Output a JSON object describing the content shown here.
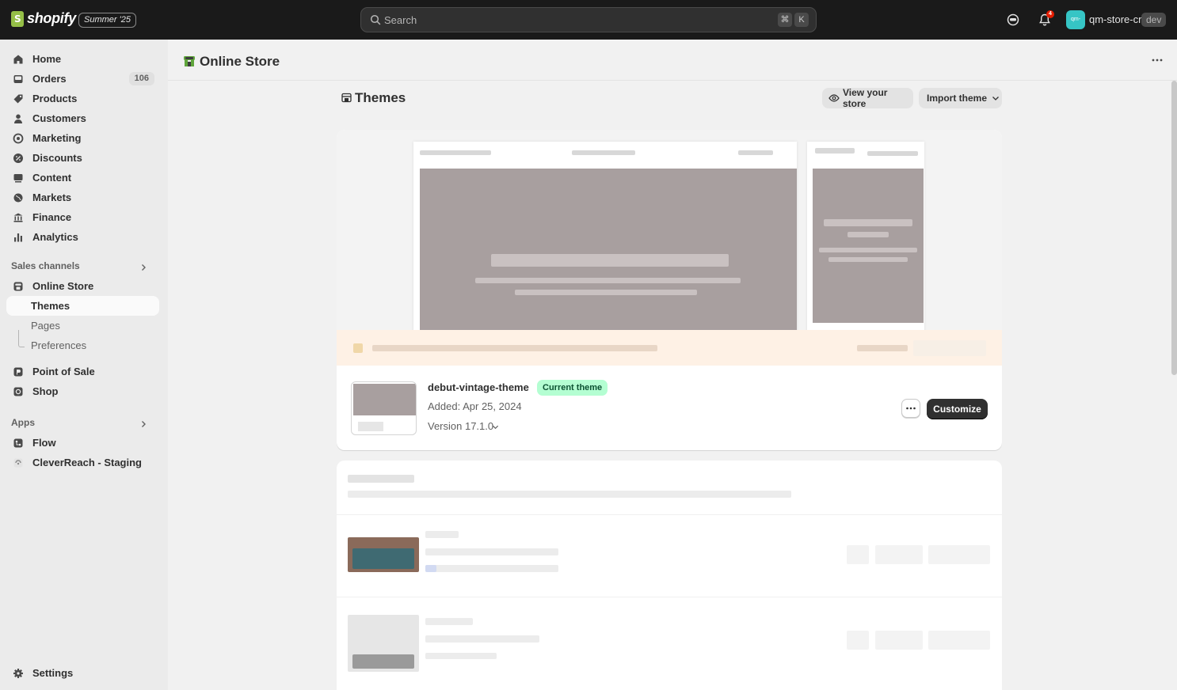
{
  "topbar": {
    "brand": "shopify",
    "edition_badge": "Summer '25",
    "search_placeholder": "Search",
    "shortcut_keys": [
      "⌘",
      "K"
    ],
    "notification_count": "4",
    "avatar_initials": "qm-",
    "store_name": "qm-store-cr",
    "env_badge": "dev"
  },
  "sidebar": {
    "items": [
      {
        "label": "Home",
        "icon": "home-icon"
      },
      {
        "label": "Orders",
        "icon": "inbox-icon",
        "count": "106"
      },
      {
        "label": "Products",
        "icon": "tag-icon"
      },
      {
        "label": "Customers",
        "icon": "person-icon"
      },
      {
        "label": "Marketing",
        "icon": "target-icon"
      },
      {
        "label": "Discounts",
        "icon": "discount-icon"
      },
      {
        "label": "Content",
        "icon": "content-icon"
      },
      {
        "label": "Markets",
        "icon": "globe-icon"
      },
      {
        "label": "Finance",
        "icon": "bank-icon"
      },
      {
        "label": "Analytics",
        "icon": "bar-chart-icon"
      }
    ],
    "sales_channels_label": "Sales channels",
    "online_store": "Online Store",
    "online_store_sub": [
      "Themes",
      "Pages",
      "Preferences"
    ],
    "channels": [
      {
        "label": "Point of Sale",
        "icon": "pos-icon"
      },
      {
        "label": "Shop",
        "icon": "shop-icon"
      }
    ],
    "apps_label": "Apps",
    "apps": [
      {
        "label": "Flow",
        "icon": "flow-icon"
      },
      {
        "label": "CleverReach - Staging",
        "icon": "cleverreach-icon"
      }
    ],
    "settings": "Settings"
  },
  "main": {
    "page_title": "Online Store",
    "section_title": "Themes",
    "view_store_label": "View your store",
    "import_theme_label": "Import theme",
    "current_theme": {
      "name": "debut-vintage-theme",
      "badge": "Current theme",
      "added": "Added: Apr 25, 2024",
      "version": "Version 17.1.0",
      "customize_label": "Customize"
    }
  },
  "colors": {
    "topbar_bg": "#1a1a1a",
    "accent_green": "#b4fed2",
    "primary_button": "#303030",
    "notification_red": "#e51c00"
  }
}
